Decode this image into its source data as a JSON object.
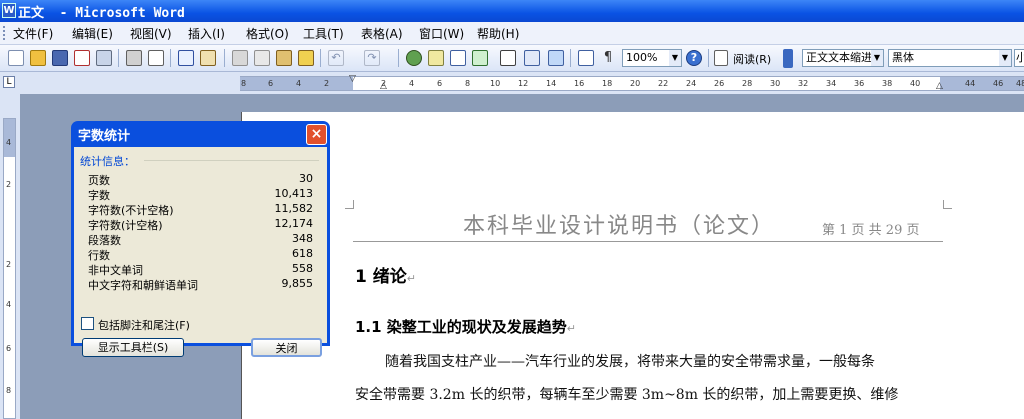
{
  "window": {
    "title": "正文  - Microsoft Word"
  },
  "menu": {
    "items": [
      "文件(F)",
      "编辑(E)",
      "视图(V)",
      "插入(I)",
      "格式(O)",
      "工具(T)",
      "表格(A)",
      "窗口(W)",
      "帮助(H)"
    ]
  },
  "toolbar": {
    "zoom": "100%",
    "read_label": "阅读(R)",
    "style": "正文文本缩进",
    "font": "黑体",
    "font_size": "小"
  },
  "ruler": {
    "numbers": [
      "8",
      "6",
      "4",
      "2",
      "2",
      "4",
      "6",
      "8",
      "10",
      "12",
      "14",
      "16",
      "18",
      "20",
      "22",
      "24",
      "26",
      "28",
      "30",
      "32",
      "34",
      "36",
      "38",
      "40",
      "44",
      "46",
      "48"
    ],
    "vertical_numbers": [
      "4",
      "2",
      "2",
      "4",
      "6",
      "8"
    ]
  },
  "document": {
    "header_title": "本科毕业设计说明书（论文）",
    "header_page": "第 1 页  共 29 页",
    "heading1": "1   绪论",
    "heading2": "1.1   染整工业的现状及发展趋势",
    "para_line1": "随着我国支柱产业——汽车行业的发展，将带来大量的安全带需求量，一般每条",
    "para_line2": "安全带需要 3.2m 长的织带，每辆车至少需要 3m~8m 长的织带，加上需要更换、维修",
    "paragraph_mark": "↵"
  },
  "dialog": {
    "title": "字数统计",
    "group_label": "统计信息：",
    "stats": [
      {
        "label": "页数",
        "value": "30"
      },
      {
        "label": "字数",
        "value": "10,413"
      },
      {
        "label": "字符数(不计空格)",
        "value": "11,582"
      },
      {
        "label": "字符数(计空格)",
        "value": "12,174"
      },
      {
        "label": "段落数",
        "value": "348"
      },
      {
        "label": "行数",
        "value": "618"
      },
      {
        "label": "非中文单词",
        "value": "558"
      },
      {
        "label": "中文字符和朝鲜语单词",
        "value": "9,855"
      }
    ],
    "checkbox_label": "包括脚注和尾注(F)",
    "toolbar_button": "显示工具栏(S)",
    "close_button": "关闭",
    "close_icon": "×"
  }
}
